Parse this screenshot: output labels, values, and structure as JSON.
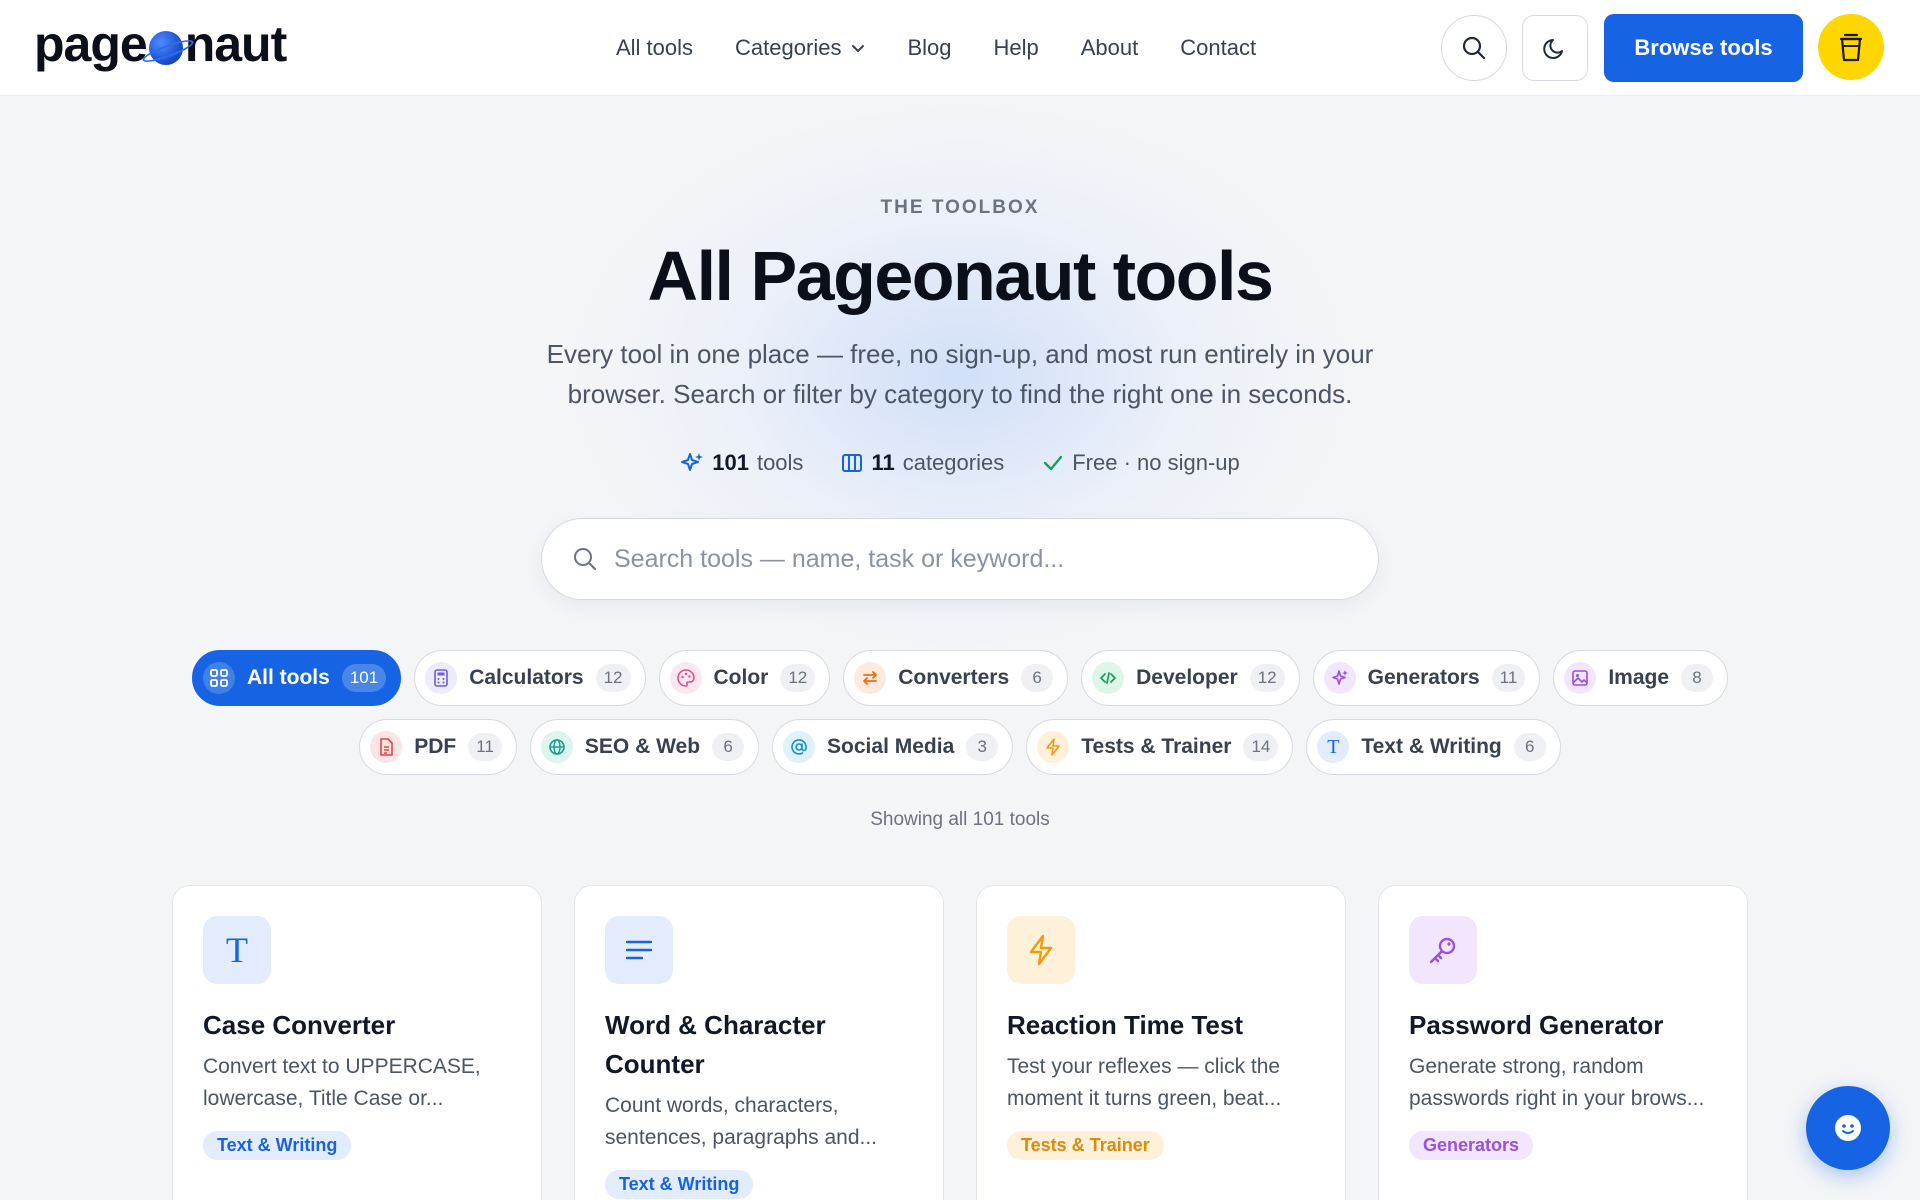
{
  "header": {
    "logo_left": "page",
    "logo_right": "naut",
    "nav": [
      {
        "label": "All tools"
      },
      {
        "label": "Categories"
      },
      {
        "label": "Blog"
      },
      {
        "label": "Help"
      },
      {
        "label": "About"
      },
      {
        "label": "Contact"
      }
    ],
    "browse_label": "Browse tools"
  },
  "hero": {
    "eyebrow": "THE TOOLBOX",
    "title": "All Pageonaut tools",
    "subtitle": "Every tool in one place — free, no sign-up, and most run entirely in your browser. Search or filter by category to find the right one in seconds.",
    "stats": {
      "tools_count": "101",
      "tools_label": "tools",
      "categories_count": "11",
      "categories_label": "categories",
      "free_label": "Free · no sign-up"
    },
    "search_placeholder": "Search tools — name, task or keyword..."
  },
  "chips": [
    {
      "label": "All tools",
      "count": "101",
      "icon": "grid-icon"
    },
    {
      "label": "Calculators",
      "count": "12",
      "icon": "calculator-icon"
    },
    {
      "label": "Color",
      "count": "12",
      "icon": "palette-icon"
    },
    {
      "label": "Converters",
      "count": "6",
      "icon": "swap-icon"
    },
    {
      "label": "Developer",
      "count": "12",
      "icon": "code-icon"
    },
    {
      "label": "Generators",
      "count": "11",
      "icon": "sparkle-icon"
    },
    {
      "label": "Image",
      "count": "8",
      "icon": "image-icon"
    },
    {
      "label": "PDF",
      "count": "11",
      "icon": "file-icon"
    },
    {
      "label": "SEO & Web",
      "count": "6",
      "icon": "globe-icon"
    },
    {
      "label": "Social Media",
      "count": "3",
      "icon": "at-icon"
    },
    {
      "label": "Tests & Trainer",
      "count": "14",
      "icon": "bolt-icon"
    },
    {
      "label": "Text & Writing",
      "count": "6",
      "icon": "text-icon"
    }
  ],
  "showing_text": "Showing all 101 tools",
  "cards": [
    {
      "title": "Case Converter",
      "desc_1": "Convert text to UPPERCASE,",
      "desc_2": "lowercase, Title Case or...",
      "tag": "Text & Writing",
      "icon": "text-icon"
    },
    {
      "title": "Word & Character Counter",
      "desc_1": "Count words, characters,",
      "desc_2": "sentences, paragraphs and...",
      "tag": "Text & Writing",
      "icon": "lines-icon"
    },
    {
      "title": "Reaction Time Test",
      "desc_1": "Test your reflexes — click the",
      "desc_2": "moment it turns green, beat...",
      "tag": "Tests & Trainer",
      "icon": "bolt-icon"
    },
    {
      "title": "Password Generator",
      "desc_1": "Generate strong, random",
      "desc_2": "passwords right in your brows...",
      "tag": "Generators",
      "icon": "key-icon"
    }
  ],
  "colors": {
    "accent": "#1664e4",
    "coffee": "#ffd600"
  }
}
